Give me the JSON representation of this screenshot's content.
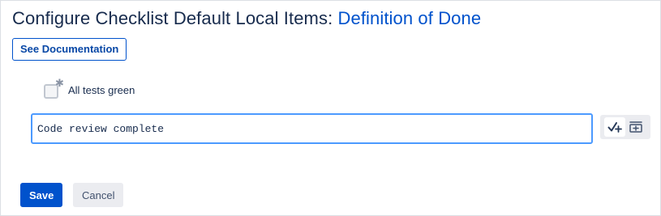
{
  "header": {
    "title_prefix": "Configure Checklist Default Local Items: ",
    "title_link": "Definition of Done"
  },
  "actions": {
    "documentation_label": "See Documentation"
  },
  "checklist": {
    "items": [
      {
        "label": "All tests green",
        "checked": false,
        "marker_icon": "asterisk-icon"
      }
    ]
  },
  "new_item": {
    "value": "Code review complete"
  },
  "toolbar": {
    "icons": [
      "add-checkmark-icon",
      "insert-section-icon"
    ]
  },
  "footer": {
    "save_label": "Save",
    "cancel_label": "Cancel"
  },
  "colors": {
    "primary": "#0052cc",
    "title_text": "#172b4d",
    "focus_border": "#4c9aff",
    "subtle_bg": "#ebecf0"
  }
}
